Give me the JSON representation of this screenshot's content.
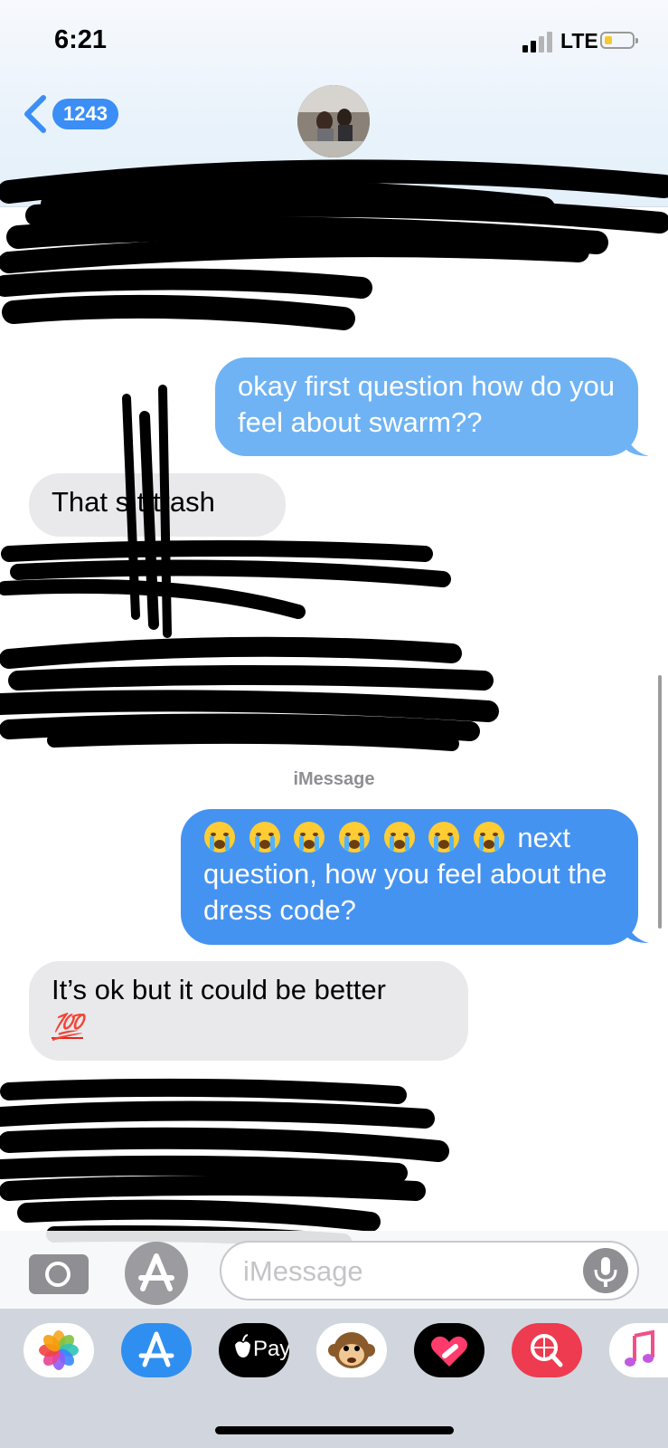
{
  "status_bar": {
    "time": "6:21",
    "network": "LTE"
  },
  "nav": {
    "unread_count": "1243"
  },
  "messages": {
    "sent_1": "okay first question how do you feel about swarm??",
    "recv_1": "That s   t trash",
    "service_label": "iMessage",
    "sent_2_text": "next question, how you feel about the dress code?",
    "recv_2": "It’s ok but it could be better",
    "recv_2_emoji": "💯"
  },
  "composer": {
    "placeholder": "iMessage"
  },
  "app_drawer": {
    "apps": [
      "photos-app",
      "app-store-app",
      "apple-pay-app",
      "animoji-app",
      "digital-touch-app",
      "search-images-app",
      "music-app"
    ],
    "apple_pay_label": "Pay"
  }
}
